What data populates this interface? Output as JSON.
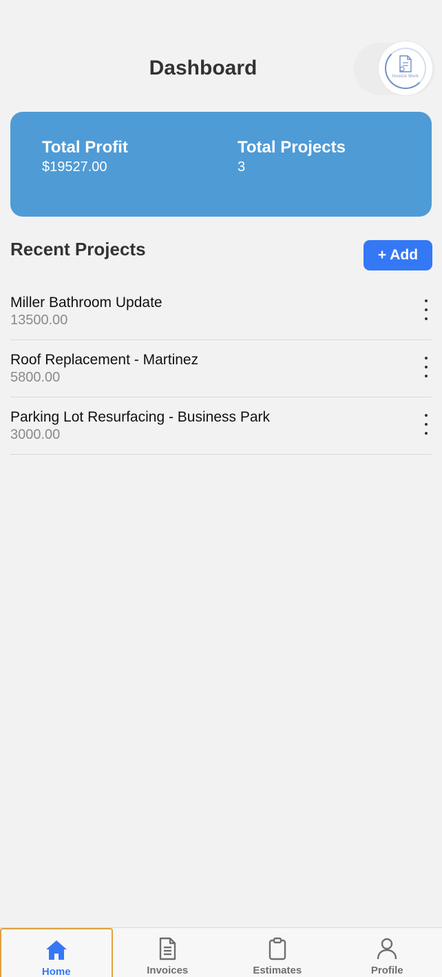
{
  "header": {
    "title": "Dashboard",
    "logo_icon": "invoice-document-icon",
    "logo_text": "Invoice Work"
  },
  "summary": {
    "profit_label": "Total Profit",
    "profit_value": "$19527.00",
    "projects_label": "Total Projects",
    "projects_value": "3",
    "card_color": "#4f9bd6"
  },
  "recent": {
    "title": "Recent Projects",
    "add_label": "+ Add",
    "projects": [
      {
        "name": "Miller Bathroom Update",
        "amount": "13500.00"
      },
      {
        "name": "Roof Replacement - Martinez",
        "amount": "5800.00"
      },
      {
        "name": "Parking Lot Resurfacing - Business Park",
        "amount": "3000.00"
      }
    ]
  },
  "nav": {
    "items": [
      {
        "label": "Home",
        "icon": "home-icon",
        "active": true
      },
      {
        "label": "Invoices",
        "icon": "document-icon",
        "active": false
      },
      {
        "label": "Estimates",
        "icon": "clipboard-icon",
        "active": false
      },
      {
        "label": "Profile",
        "icon": "person-icon",
        "active": false
      }
    ]
  },
  "colors": {
    "accent": "#3478f6",
    "background": "#f2f2f2"
  }
}
